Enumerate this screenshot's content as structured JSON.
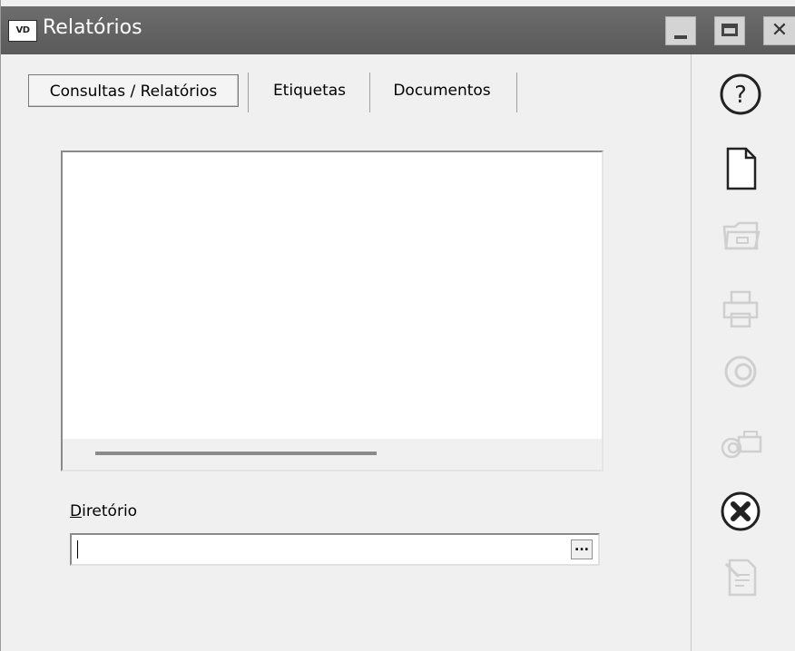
{
  "window": {
    "app_icon_text": "VD",
    "title": "Relatórios"
  },
  "title_buttons": [
    "minimize",
    "maximize",
    "close"
  ],
  "tabs": [
    {
      "label": "Consultas / Relatórios",
      "active": true
    },
    {
      "label": "Etiquetas",
      "active": false
    },
    {
      "label": "Documentos",
      "active": false
    }
  ],
  "directory": {
    "label_first": "D",
    "label_rest": "iretório",
    "value": "",
    "browse_label": "..."
  },
  "toolbar": {
    "icons": [
      {
        "name": "help-icon",
        "enabled": true
      },
      {
        "name": "new-document-icon",
        "enabled": true
      },
      {
        "name": "open-folder-icon",
        "enabled": false
      },
      {
        "name": "print-icon",
        "enabled": false
      },
      {
        "name": "preview-eye-icon",
        "enabled": false
      },
      {
        "name": "preview-print-icon",
        "enabled": false
      },
      {
        "name": "close-circle-icon",
        "enabled": true
      },
      {
        "name": "edit-document-icon",
        "enabled": false
      }
    ]
  }
}
